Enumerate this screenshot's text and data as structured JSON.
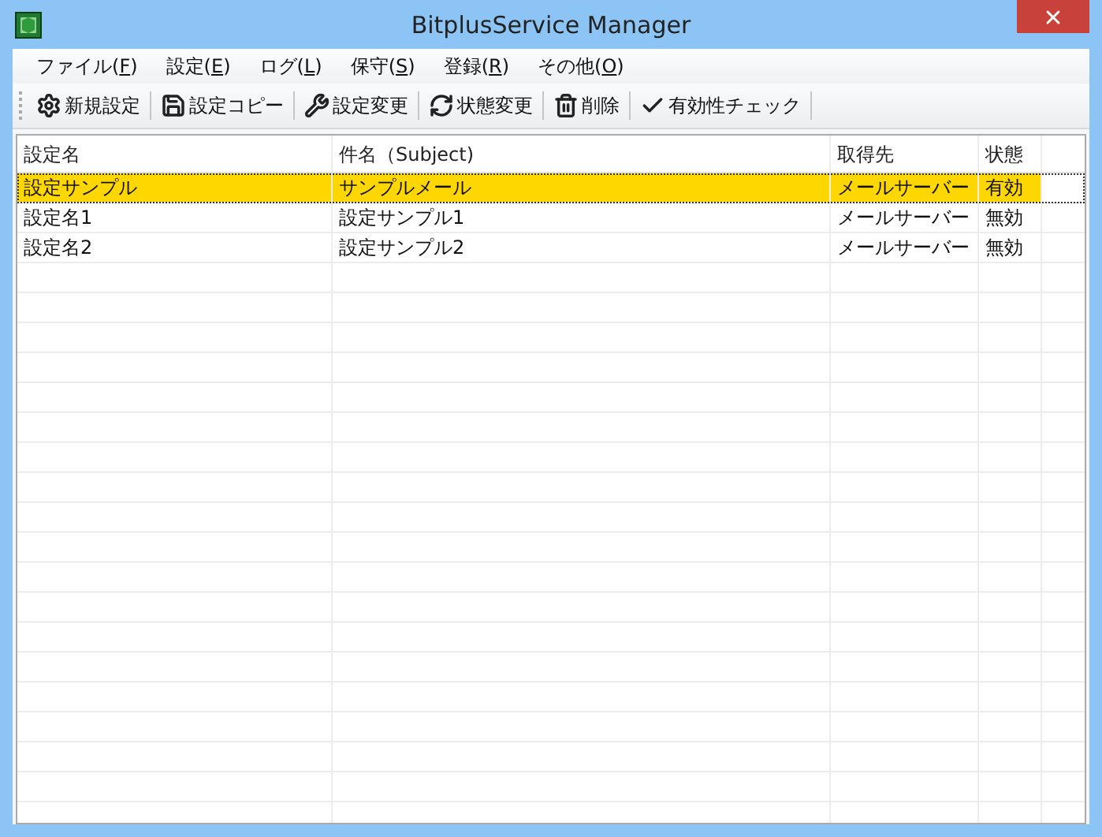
{
  "window": {
    "title": "BitplusService Manager"
  },
  "menu": [
    {
      "before": "ファイル(",
      "key": "F",
      "after": ")"
    },
    {
      "before": "設定(",
      "key": "E",
      "after": ")"
    },
    {
      "before": "ログ(",
      "key": "L",
      "after": ")"
    },
    {
      "before": "保守(",
      "key": "S",
      "after": ")"
    },
    {
      "before": "登録(",
      "key": "R",
      "after": ")"
    },
    {
      "before": "その他(",
      "key": "O",
      "after": ")"
    }
  ],
  "toolbar": [
    "新規設定",
    "設定コピー",
    "設定変更",
    "状態変更",
    "削除",
    "有効性チェック"
  ],
  "table": {
    "columns": [
      "設定名",
      "件名（Subject)",
      "取得先",
      "状態"
    ],
    "rows": [
      {
        "cells": [
          "設定サンプル",
          "サンプルメール",
          "メールサーバー",
          "有効"
        ],
        "selected": true
      },
      {
        "cells": [
          "設定名1",
          "設定サンプル1",
          "メールサーバー",
          "無効"
        ],
        "selected": false
      },
      {
        "cells": [
          "設定名2",
          "設定サンプル2",
          "メールサーバー",
          "無効"
        ],
        "selected": false
      }
    ]
  }
}
